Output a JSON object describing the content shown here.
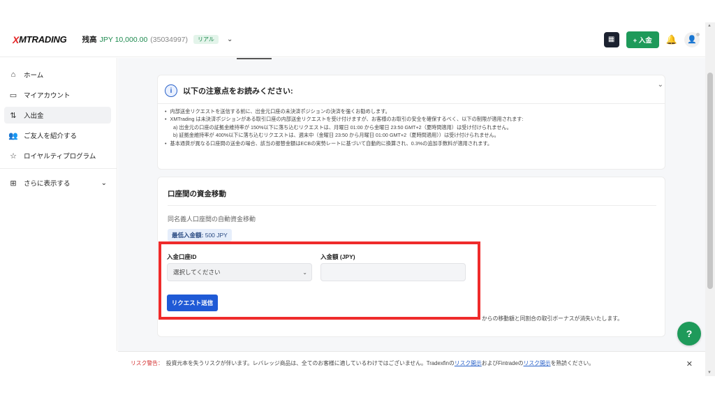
{
  "header": {
    "logo_prefix": "X",
    "logo_text": "MTRADING",
    "balance_label": "残高",
    "balance_amount": "JPY 10,000.00",
    "account_number": "(35034997)",
    "account_type": "リアル",
    "deposit_label": "+ 入金",
    "icons": [
      "qr-icon",
      "bell-icon",
      "user-icon",
      "chevron-down-icon"
    ]
  },
  "sidebar": {
    "items": [
      {
        "label": "ホーム",
        "icon": "home-icon"
      },
      {
        "label": "マイアカウント",
        "icon": "card-icon"
      },
      {
        "label": "入出金",
        "icon": "transfer-icon",
        "active": true
      },
      {
        "label": "ご友人を紹介する",
        "icon": "users-icon"
      },
      {
        "label": "ロイヤルティプログラム",
        "icon": "star-icon"
      }
    ],
    "more_label": "さらに表示する"
  },
  "notice": {
    "title": "以下の注意点をお読みください:",
    "lines": [
      "内部送金リクエストを送信する前に、出金元口座の未決済ポジションの決済を強くお勧めします。",
      "XMTrading は未決済ポジションがある取引口座の内部送金リクエストを受け付けますが、お客様のお取引の安全を確保するべく、以下の制限が適用されます:",
      "a) 出金元の口座の証拠金維持率が 150%以下に落ち込むリクエストは、月曜日 01:00 から金曜日 23:50 GMT+2（夏時間適用）は受け付けられません。",
      "b) 証拠金維持率が 400%以下に落ち込むリクエストは、週末中（金曜日 23:50 から月曜日 01:00 GMT+2（夏時間適用））は受け付けられません。",
      "基本通貨が異なる口座間の送金の場合、該当の振替金額はECBの実勢レートに基づいて自動的に換算され、0.3%の追加手数料が適用されます。"
    ]
  },
  "transfer": {
    "title": "口座間の資金移動",
    "subtitle": "同名義人口座間の自動資金移動",
    "min_label": "最低入金額:",
    "min_value": "500 JPY",
    "account_id_label": "入金口座ID",
    "select_placeholder": "選択してください",
    "amount_label": "入金額 (JPY)",
    "amount_value": "",
    "submit_label": "リクエスト送信",
    "bonus_note": "からの移動額と同割合の取引ボーナスが消失いたします。"
  },
  "footer": {
    "warning_label": "リスク警告：",
    "text_1": "投資元本を失うリスクが伴います。レバレッジ商品は、全てのお客様に適しているわけではございません。Tradexfinの",
    "link_1": "リスク開示",
    "text_2": "およびFintradeの",
    "link_2": "リスク開示",
    "text_3": "を熟読ください。",
    "close": "✕"
  },
  "colors": {
    "brand_green": "#1e9a5a",
    "primary_blue": "#1f5ad6",
    "highlight_red": "#ef2b2b",
    "logo_red": "#e32526"
  }
}
